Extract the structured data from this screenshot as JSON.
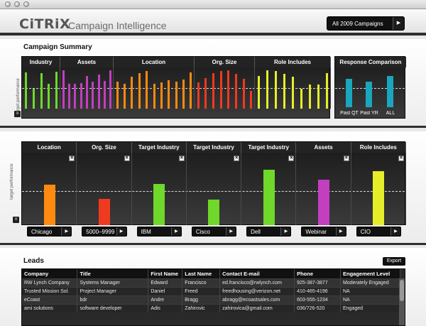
{
  "header": {
    "logo": "CiTRiX",
    "title": "Campaign Intelligence",
    "campaign_selector": "All 2009 Campaigns"
  },
  "summary": {
    "title": "Campaign Summary",
    "y_axis_label": "target performance",
    "columns": [
      "Industry",
      "Assets",
      "Location",
      "Org. Size",
      "Role Includes"
    ],
    "response_title": "Response Comparison",
    "response_labels": [
      "Past QT",
      "Past YR",
      "ALL"
    ]
  },
  "detail": {
    "y_axis_label": "target performance",
    "columns": [
      "Location",
      "Org. Size",
      "Target Industry",
      "Target Industry",
      "Target Industry",
      "Assets",
      "Role Includes"
    ],
    "selects": [
      "Chicago",
      "5000–9999",
      "IBM",
      "Cisco",
      "Dell",
      "Webinar",
      "CIO"
    ]
  },
  "leads": {
    "title": "Leads",
    "export_label": "Export",
    "columns": [
      "Company",
      "Title",
      "First Name",
      "Last Name",
      "Contact E-mail",
      "Phone",
      "Engagement Level"
    ],
    "rows": [
      [
        "RW Lynch Company",
        "Systems Manager",
        "Edward",
        "Francisco",
        "ed.francisco@rwlynch.com",
        "925-387-3877",
        "Moderately Engaged"
      ],
      [
        "Trusted Mission Sol.",
        "Project Manager",
        "Daniel",
        "Freed",
        "freedhousing@verizon.net",
        "410-465-4196",
        "NA"
      ],
      [
        "eCoast",
        "bdr",
        "Andre",
        "Bragg",
        "abragg@ecoastsales.com",
        "603-555-1234",
        "NA"
      ],
      [
        "ami solutions",
        "software developer",
        "Adis",
        "Zahirovic",
        "zahirovica@gmail.com",
        "036/726-520",
        "Engaged"
      ]
    ]
  },
  "colors": {
    "green": "#6fd82a",
    "magenta": "#c23fbf",
    "orange": "#ff8a10",
    "red": "#f03a20",
    "yellow": "#e6ee2a",
    "teal": "#1aa6bd"
  },
  "summary_bar_levels": {
    "industry": [
      0.88,
      0.49,
      0.86,
      0.6,
      0.9
    ],
    "assets": [
      0.93,
      0.6,
      0.61,
      0.62,
      0.8,
      0.65,
      0.82,
      0.67,
      0.93
    ],
    "location": [
      0.66,
      0.61,
      0.78,
      0.86,
      0.92,
      0.6,
      0.63,
      0.69,
      0.66,
      0.71,
      0.88
    ],
    "org_size": [
      0.63,
      0.75,
      0.86,
      0.92,
      0.93,
      0.85,
      0.72,
      0.43
    ],
    "role": [
      0.79,
      0.93,
      0.91,
      0.84,
      0.78,
      0.49,
      0.58,
      0.58,
      0.86
    ],
    "response": [
      0.69,
      0.62,
      0.76
    ]
  },
  "detail_bar_levels": [
    0.56,
    0.36,
    0.57,
    0.35,
    0.76,
    0.63,
    0.75
  ]
}
